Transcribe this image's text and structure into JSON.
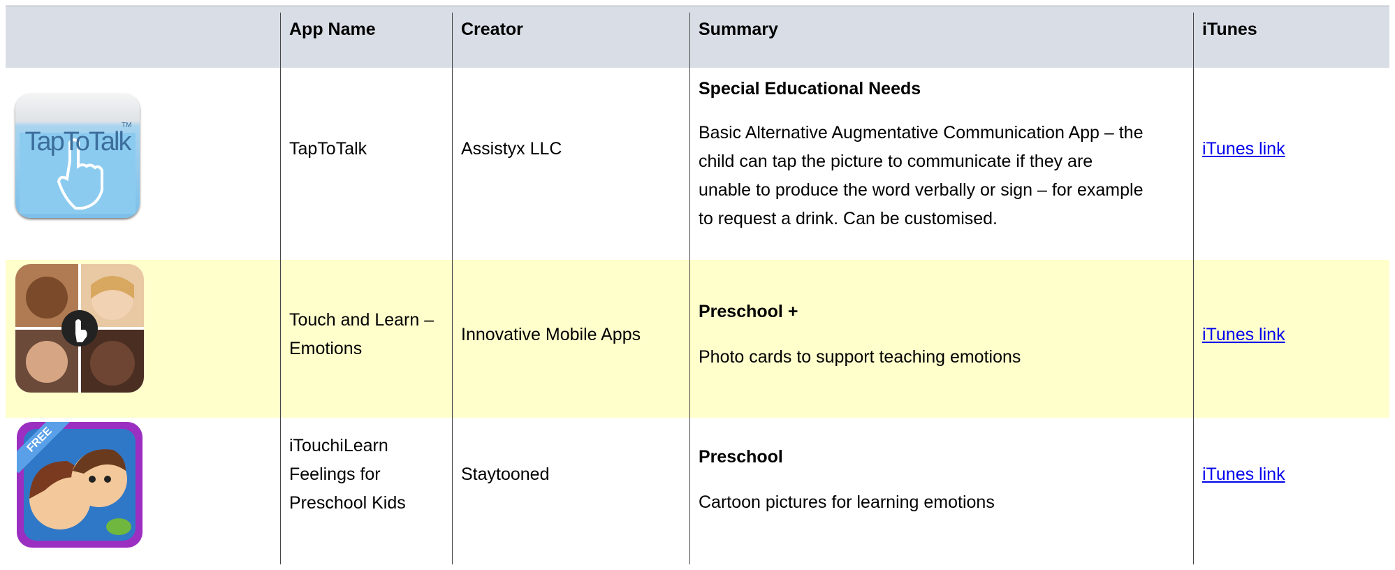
{
  "header": {
    "app_name": "App Name",
    "creator": "Creator",
    "summary": "Summary",
    "itunes": "iTunes"
  },
  "rows": [
    {
      "icon": "taptotalk-app-icon",
      "icon_text": "TapToTalk",
      "icon_tm": "TM",
      "app_name": "TapToTalk",
      "creator": "Assistyx LLC",
      "summary_title": "Special Educational Needs",
      "summary_lines": [
        "Basic Alternative Augmentative Communication App – the",
        "child can tap the picture to communicate if they are",
        "unable to produce the word verbally or sign – for example",
        "to request a drink. Can be customised."
      ],
      "link": "iTunes link"
    },
    {
      "icon": "touch-and-learn-emotions-app-icon",
      "app_name_lines": [
        "Touch and Learn –",
        "Emotions"
      ],
      "creator": "Innovative Mobile Apps",
      "summary_title": "Preschool +",
      "summary": "Photo cards to support teaching emotions",
      "link": "iTunes link",
      "highlight": "#ffffcc"
    },
    {
      "icon": "itouchilearn-feelings-app-icon",
      "icon_badge": "FREE",
      "app_name_lines": [
        "iTouchiLearn",
        "Feelings for",
        "Preschool Kids"
      ],
      "creator": "Staytooned",
      "summary_title": "Preschool",
      "summary": "Cartoon pictures for learning emotions",
      "link": "iTunes link"
    }
  ]
}
